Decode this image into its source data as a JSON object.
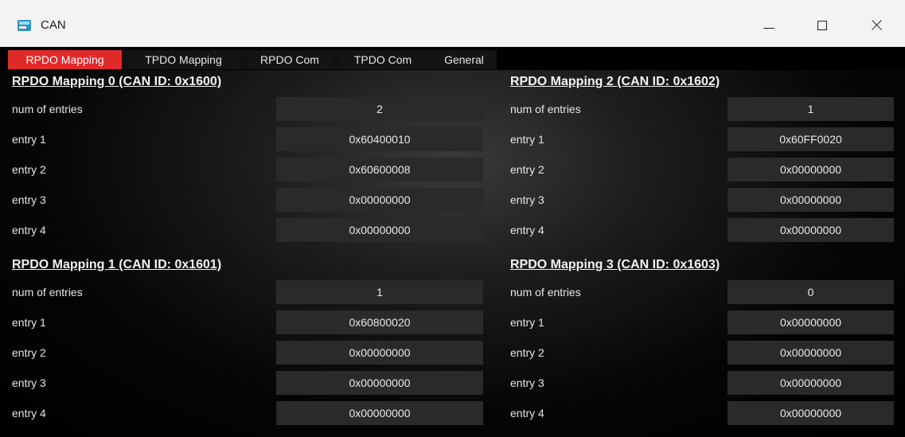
{
  "window": {
    "title": "CAN"
  },
  "tabs": [
    {
      "label": "RPDO Mapping",
      "active": true
    },
    {
      "label": "TPDO Mapping",
      "active": false
    },
    {
      "label": "RPDO Com",
      "active": false
    },
    {
      "label": "TPDO Com",
      "active": false
    },
    {
      "label": "General",
      "active": false
    }
  ],
  "row_labels": {
    "num": "num of entries",
    "e1": "entry 1",
    "e2": "entry 2",
    "e3": "entry 3",
    "e4": "entry 4"
  },
  "mappings": [
    {
      "title": "RPDO Mapping 0 (CAN ID: 0x1600)",
      "num_entries": "2",
      "entries": [
        "0x60400010",
        "0x60600008",
        "0x00000000",
        "0x00000000"
      ]
    },
    {
      "title": "RPDO Mapping 1 (CAN ID: 0x1601)",
      "num_entries": "1",
      "entries": [
        "0x60800020",
        "0x00000000",
        "0x00000000",
        "0x00000000"
      ]
    },
    {
      "title": "RPDO Mapping 2 (CAN ID: 0x1602)",
      "num_entries": "1",
      "entries": [
        "0x60FF0020",
        "0x00000000",
        "0x00000000",
        "0x00000000"
      ]
    },
    {
      "title": "RPDO Mapping 3 (CAN ID: 0x1603)",
      "num_entries": "0",
      "entries": [
        "0x00000000",
        "0x00000000",
        "0x00000000",
        "0x00000000"
      ]
    }
  ],
  "colors": {
    "active_tab": "#e02a2a",
    "value_box": "#2a2a2a",
    "background": "#000000"
  }
}
